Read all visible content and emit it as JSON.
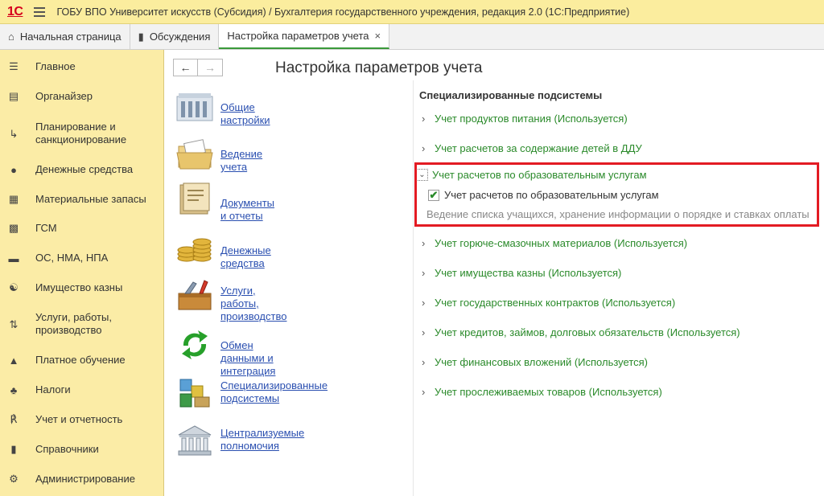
{
  "titlebar": {
    "logo": "1С",
    "title": "ГОБУ ВПО Университет искусств (Субсидия) / Бухгалтерия государственного учреждения, редакция 2.0  (1С:Предприятие)"
  },
  "tabs": [
    {
      "label": "Начальная страница",
      "icon": "home-icon"
    },
    {
      "label": "Обсуждения",
      "icon": "chat-icon"
    },
    {
      "label": "Настройка параметров учета",
      "icon": "",
      "active": true
    }
  ],
  "tab_close": "×",
  "sidebar": {
    "items": [
      {
        "label": "Главное",
        "icon": "menu-icon"
      },
      {
        "label": "Органайзер",
        "icon": "organizer-icon"
      },
      {
        "label": "Планирование и\nсанкционирование",
        "icon": "planning-icon"
      },
      {
        "label": "Денежные средства",
        "icon": "money-icon"
      },
      {
        "label": "Материальные запасы",
        "icon": "inventory-icon"
      },
      {
        "label": "ГСМ",
        "icon": "fuel-icon"
      },
      {
        "label": "ОС, НМА, НПА",
        "icon": "truck-icon"
      },
      {
        "label": "Имущество казны",
        "icon": "treasury-icon"
      },
      {
        "label": "Услуги, работы,\nпроизводство",
        "icon": "services-icon"
      },
      {
        "label": "Платное обучение",
        "icon": "graduation-icon"
      },
      {
        "label": "Налоги",
        "icon": "taxes-icon"
      },
      {
        "label": "Учет и отчетность",
        "icon": "accounting-icon"
      },
      {
        "label": "Справочники",
        "icon": "book-icon"
      },
      {
        "label": "Администрирование",
        "icon": "gear-icon"
      }
    ]
  },
  "nav": {
    "back": "←",
    "forward": "→"
  },
  "page_title": "Настройка параметров учета",
  "sections": [
    {
      "label": "Общие настройки",
      "icon": "building-icon"
    },
    {
      "label": "Ведение учета",
      "icon": "folder-icon"
    },
    {
      "label": "Документы и отчеты",
      "icon": "documents-icon"
    },
    {
      "label": "Денежные средства",
      "icon": "coins-icon"
    },
    {
      "label": "Услуги, работы,\nпроизводство",
      "icon": "toolbox-icon"
    },
    {
      "label": "Обмен данными и интеграция",
      "icon": "sync-icon"
    },
    {
      "label": "Специализированные\nподсистемы",
      "icon": "blocks-icon"
    },
    {
      "label": "Централизуемые\nполномочия",
      "icon": "temple-icon"
    }
  ],
  "subsystems": {
    "heading": "Специализированные подсистемы",
    "groups_top": [
      "Учет продуктов питания (Используется)",
      "Учет расчетов за содержание детей в ДДУ"
    ],
    "expanded": {
      "label": "Учет расчетов по образовательным услугам",
      "checkbox_label": "Учет расчетов по образовательным услугам",
      "checked": true,
      "description": "Ведение списка учащихся, хранение информации о порядке и ставках оплаты"
    },
    "groups_bottom": [
      "Учет горюче-смазочных материалов (Используется)",
      "Учет имущества казны (Используется)",
      "Учет государственных контрактов (Используется)",
      "Учет кредитов, займов, долговых обязательств (Используется)",
      "Учет финансовых вложений (Используется)",
      "Учет прослеживаемых товаров (Используется)"
    ]
  },
  "colors": {
    "accent_green": "#2a8a2a",
    "highlight_red": "#e31b23",
    "sidebar_bg": "#fbeca6",
    "link_blue": "#2a4fb0"
  }
}
